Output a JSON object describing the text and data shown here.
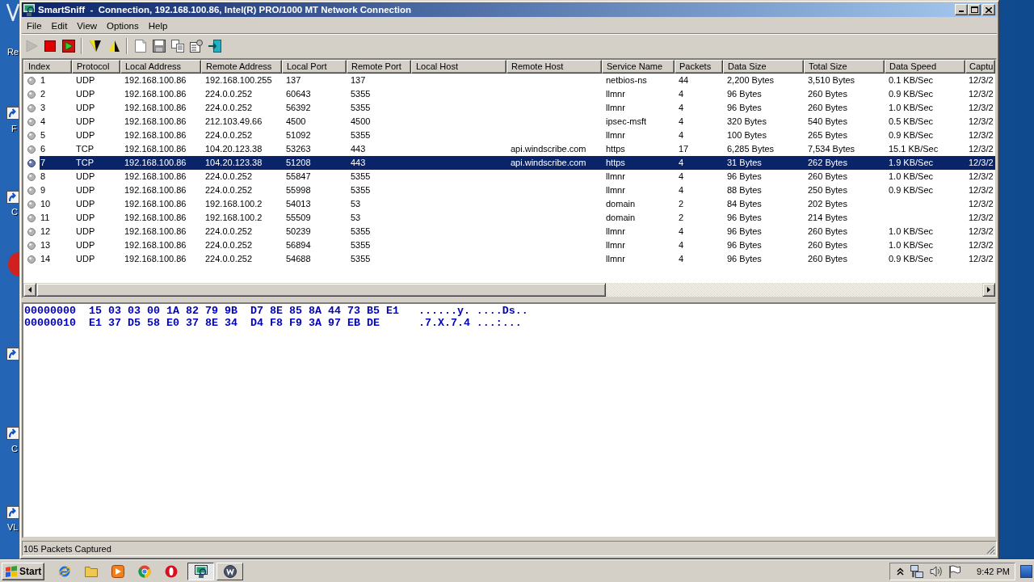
{
  "desktop": {
    "icons": [
      {
        "kind": "generic",
        "label": "Re"
      },
      {
        "kind": "shortcut",
        "label": "F"
      },
      {
        "kind": "shortcut",
        "label": "C"
      },
      {
        "kind": "disc"
      },
      {
        "kind": "shortcut"
      },
      {
        "kind": "shortcut",
        "label": "C"
      },
      {
        "kind": "shortcut",
        "label": "VL"
      }
    ]
  },
  "window": {
    "title": "SmartSniff  -  Connection, 192.168.100.86, Intel(R) PRO/1000 MT Network Connection",
    "menu": [
      "File",
      "Edit",
      "View",
      "Options",
      "Help"
    ]
  },
  "toolbar": {
    "groups": [
      [
        {
          "kind": "play",
          "disabled": true
        },
        {
          "kind": "stop",
          "disabled": false
        },
        {
          "kind": "playsquare",
          "disabled": false
        }
      ],
      [
        {
          "kind": "funnel",
          "disabled": false
        },
        {
          "kind": "triangle",
          "disabled": false
        }
      ],
      [
        {
          "kind": "page",
          "disabled": false
        },
        {
          "kind": "floppy",
          "disabled": false
        },
        {
          "kind": "copy",
          "disabled": false
        },
        {
          "kind": "properties",
          "disabled": false
        },
        {
          "kind": "exit",
          "disabled": false
        }
      ]
    ]
  },
  "table": {
    "columns": [
      "Index",
      "Protocol",
      "Local Address",
      "Remote Address",
      "Local Port",
      "Remote Port",
      "Local Host",
      "Remote Host",
      "Service Name",
      "Packets",
      "Data Size",
      "Total Size",
      "Data Speed",
      "Captu"
    ],
    "rows": [
      {
        "selected": false,
        "index": "1",
        "protocol": "UDP",
        "local_address": "192.168.100.86",
        "remote_address": "192.168.100.255",
        "local_port": "137",
        "remote_port": "137",
        "service_name": "netbios-ns",
        "packets": "44",
        "data_size": "2,200 Bytes",
        "total_size": "3,510 Bytes",
        "data_speed": "0.1 KB/Sec",
        "column_14": "12/3/2"
      },
      {
        "selected": false,
        "index": "2",
        "protocol": "UDP",
        "local_address": "192.168.100.86",
        "remote_address": "224.0.0.252",
        "local_port": "60643",
        "remote_port": "5355",
        "service_name": "llmnr",
        "packets": "4",
        "data_size": "96 Bytes",
        "total_size": "260 Bytes",
        "data_speed": "0.9 KB/Sec",
        "column_14": "12/3/2"
      },
      {
        "selected": false,
        "index": "3",
        "protocol": "UDP",
        "local_address": "192.168.100.86",
        "remote_address": "224.0.0.252",
        "local_port": "56392",
        "remote_port": "5355",
        "service_name": "llmnr",
        "packets": "4",
        "data_size": "96 Bytes",
        "total_size": "260 Bytes",
        "data_speed": "1.0 KB/Sec",
        "column_14": "12/3/2"
      },
      {
        "selected": false,
        "index": "4",
        "protocol": "UDP",
        "local_address": "192.168.100.86",
        "remote_address": "212.103.49.66",
        "local_port": "4500",
        "remote_port": "4500",
        "service_name": "ipsec-msft",
        "packets": "4",
        "data_size": "320 Bytes",
        "total_size": "540 Bytes",
        "data_speed": "0.5 KB/Sec",
        "column_14": "12/3/2"
      },
      {
        "selected": false,
        "index": "5",
        "protocol": "UDP",
        "local_address": "192.168.100.86",
        "remote_address": "224.0.0.252",
        "local_port": "51092",
        "remote_port": "5355",
        "service_name": "llmnr",
        "packets": "4",
        "data_size": "100 Bytes",
        "total_size": "265 Bytes",
        "data_speed": "0.9 KB/Sec",
        "column_14": "12/3/2"
      },
      {
        "selected": false,
        "index": "6",
        "protocol": "TCP",
        "local_address": "192.168.100.86",
        "remote_address": "104.20.123.38",
        "local_port": "53263",
        "remote_port": "443",
        "remote_host": "api.windscribe.com",
        "service_name": "https",
        "packets": "17",
        "data_size": "6,285 Bytes",
        "total_size": "7,534 Bytes",
        "data_speed": "15.1 KB/Sec",
        "column_14": "12/3/2"
      },
      {
        "selected": true,
        "index": "7",
        "protocol": "TCP",
        "local_address": "192.168.100.86",
        "remote_address": "104.20.123.38",
        "local_port": "51208",
        "remote_port": "443",
        "remote_host": "api.windscribe.com",
        "service_name": "https",
        "packets": "4",
        "data_size": "31 Bytes",
        "total_size": "262 Bytes",
        "data_speed": "1.9 KB/Sec",
        "column_14": "12/3/2"
      },
      {
        "selected": false,
        "index": "8",
        "protocol": "UDP",
        "local_address": "192.168.100.86",
        "remote_address": "224.0.0.252",
        "local_port": "55847",
        "remote_port": "5355",
        "service_name": "llmnr",
        "packets": "4",
        "data_size": "96 Bytes",
        "total_size": "260 Bytes",
        "data_speed": "1.0 KB/Sec",
        "column_14": "12/3/2"
      },
      {
        "selected": false,
        "index": "9",
        "protocol": "UDP",
        "local_address": "192.168.100.86",
        "remote_address": "224.0.0.252",
        "local_port": "55998",
        "remote_port": "5355",
        "service_name": "llmnr",
        "packets": "4",
        "data_size": "88 Bytes",
        "total_size": "250 Bytes",
        "data_speed": "0.9 KB/Sec",
        "column_14": "12/3/2"
      },
      {
        "selected": false,
        "index": "10",
        "protocol": "UDP",
        "local_address": "192.168.100.86",
        "remote_address": "192.168.100.2",
        "local_port": "54013",
        "remote_port": "53",
        "service_name": "domain",
        "packets": "2",
        "data_size": "84 Bytes",
        "total_size": "202 Bytes",
        "column_14": "12/3/2"
      },
      {
        "selected": false,
        "index": "11",
        "protocol": "UDP",
        "local_address": "192.168.100.86",
        "remote_address": "192.168.100.2",
        "local_port": "55509",
        "remote_port": "53",
        "service_name": "domain",
        "packets": "2",
        "data_size": "96 Bytes",
        "total_size": "214 Bytes",
        "column_14": "12/3/2"
      },
      {
        "selected": false,
        "index": "12",
        "protocol": "UDP",
        "local_address": "192.168.100.86",
        "remote_address": "224.0.0.252",
        "local_port": "50239",
        "remote_port": "5355",
        "service_name": "llmnr",
        "packets": "4",
        "data_size": "96 Bytes",
        "total_size": "260 Bytes",
        "data_speed": "1.0 KB/Sec",
        "column_14": "12/3/2"
      },
      {
        "selected": false,
        "index": "13",
        "protocol": "UDP",
        "local_address": "192.168.100.86",
        "remote_address": "224.0.0.252",
        "local_port": "56894",
        "remote_port": "5355",
        "service_name": "llmnr",
        "packets": "4",
        "data_size": "96 Bytes",
        "total_size": "260 Bytes",
        "data_speed": "1.0 KB/Sec",
        "column_14": "12/3/2"
      },
      {
        "selected": false,
        "index": "14",
        "protocol": "UDP",
        "local_address": "192.168.100.86",
        "remote_address": "224.0.0.252",
        "local_port": "54688",
        "remote_port": "5355",
        "service_name": "llmnr",
        "packets": "4",
        "data_size": "96 Bytes",
        "total_size": "260 Bytes",
        "data_speed": "0.9 KB/Sec",
        "column_14": "12/3/2"
      }
    ]
  },
  "hex_dump": {
    "lines": [
      "00000000  15 03 03 00 1A 82 79 9B  D7 8E 85 8A 44 73 B5 E1   ......y. ....Ds..",
      "00000010  E1 37 D5 58 E0 37 8E 34  D4 F8 F9 3A 97 EB DE      .7.X.7.4 ...:..."
    ]
  },
  "status_bar": {
    "text": "105 Packets Captured"
  },
  "taskbar": {
    "start": "Start",
    "quick_launch": [
      {
        "kind": "swoosh"
      },
      {
        "kind": "folder"
      },
      {
        "kind": "media"
      },
      {
        "kind": "segmented"
      },
      {
        "kind": "ring"
      }
    ],
    "tasks": [
      {
        "kind": "sniffer",
        "selected": true
      },
      {
        "kind": "logo",
        "selected": false
      }
    ],
    "tray": [
      {
        "kind": "chevron"
      },
      {
        "kind": "network"
      },
      {
        "kind": "speaker"
      },
      {
        "kind": "flag"
      }
    ],
    "clock": "9:42 PM"
  }
}
